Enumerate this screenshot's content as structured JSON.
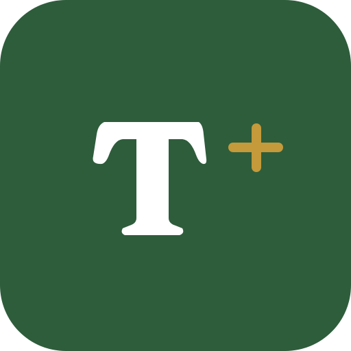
{
  "icon": {
    "letter": "T",
    "symbol": "+",
    "background_color": "#2e5d3b",
    "letter_color": "#ffffff",
    "symbol_color": "#c49a3a",
    "icon_names": [
      "letter-t-glyph",
      "plus-icon"
    ]
  }
}
